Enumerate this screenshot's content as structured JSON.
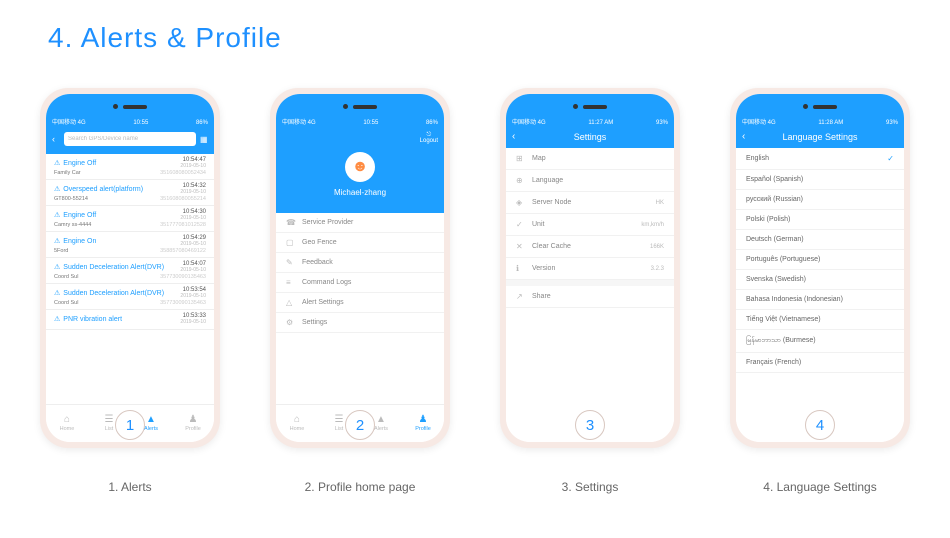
{
  "page": {
    "title": "4. Alerts & Profile"
  },
  "captions": [
    "1. Alerts",
    "2. Profile home page",
    "3. Settings",
    "4. Language Settings"
  ],
  "badges": [
    "1",
    "2",
    "3",
    "4"
  ],
  "status": {
    "carrier": "中国移动 4G",
    "time1": "10:55",
    "time2": "10:55",
    "time3": "11:27 AM",
    "time4": "11:28 AM",
    "battery1": "86%",
    "battery2": "86%",
    "battery3": "93%",
    "battery4": "93%"
  },
  "alerts": {
    "search_placeholder": "Search GPS/Device name",
    "items": [
      {
        "title": "Engine Off",
        "time": "10:54:47",
        "date": "2019-05-10",
        "device": "Family Car",
        "id": "351608080052434"
      },
      {
        "title": "Overspeed alert(platform)",
        "time": "10:54:32",
        "date": "2019-05-10",
        "device": "GT800-55214",
        "id": "351608080055214"
      },
      {
        "title": "Engine Off",
        "time": "10:54:30",
        "date": "2019-05-10",
        "device": "Camry ss-4444",
        "id": "351777081012528"
      },
      {
        "title": "Engine On",
        "time": "10:54:29",
        "date": "2019-05-10",
        "device": "5Ford",
        "id": "358857080469122"
      },
      {
        "title": "Sudden Deceleration Alert(DVR)",
        "time": "10:54:07",
        "date": "2019-05-10",
        "device": "Coord Sul",
        "id": "357730090135463"
      },
      {
        "title": "Sudden Deceleration Alert(DVR)",
        "time": "10:53:54",
        "date": "2019-05-10",
        "device": "Coord Sul",
        "id": "357730090135463"
      },
      {
        "title": "PNR vibration alert",
        "time": "10:53:33",
        "date": "2019-05-10",
        "device": "",
        "id": ""
      }
    ]
  },
  "tabs": [
    {
      "label": "Home",
      "icon": "⌂"
    },
    {
      "label": "List",
      "icon": "☰"
    },
    {
      "label": "Alerts",
      "icon": "▲"
    },
    {
      "label": "Profile",
      "icon": "♟"
    }
  ],
  "profile": {
    "username": "Michael-zhang",
    "logout": "Logout",
    "menu": [
      {
        "label": "Service Provider",
        "icon": "☎"
      },
      {
        "label": "Geo Fence",
        "icon": "▢"
      },
      {
        "label": "Feedback",
        "icon": "✎"
      },
      {
        "label": "Command Logs",
        "icon": "≡"
      },
      {
        "label": "Alert Settings",
        "icon": "△"
      },
      {
        "label": "Settings",
        "icon": "⚙"
      }
    ]
  },
  "settings": {
    "title": "Settings",
    "items": [
      {
        "label": "Map",
        "icon": "⊞",
        "value": ""
      },
      {
        "label": "Language",
        "icon": "⊕",
        "value": ""
      },
      {
        "label": "Server Node",
        "icon": "◈",
        "value": "HK"
      },
      {
        "label": "Unit",
        "icon": "✓",
        "value": "km,km/h"
      },
      {
        "label": "Clear Cache",
        "icon": "✕",
        "value": "166K"
      },
      {
        "label": "Version",
        "icon": "ℹ",
        "value": "3.2.3"
      }
    ],
    "share": {
      "label": "Share",
      "icon": "↗"
    }
  },
  "language": {
    "title": "Language Settings",
    "items": [
      {
        "label": "English",
        "selected": true
      },
      {
        "label": "Español (Spanish)",
        "selected": false
      },
      {
        "label": "русский (Russian)",
        "selected": false
      },
      {
        "label": "Polski (Polish)",
        "selected": false
      },
      {
        "label": "Deutsch (German)",
        "selected": false
      },
      {
        "label": "Português (Portuguese)",
        "selected": false
      },
      {
        "label": "Svenska (Swedish)",
        "selected": false
      },
      {
        "label": "Bahasa Indonesia (Indonesian)",
        "selected": false
      },
      {
        "label": "Tiếng Việt (Vietnamese)",
        "selected": false
      },
      {
        "label": "မြန်မာဘာသာ (Burmese)",
        "selected": false
      },
      {
        "label": "Français (French)",
        "selected": false
      }
    ]
  }
}
